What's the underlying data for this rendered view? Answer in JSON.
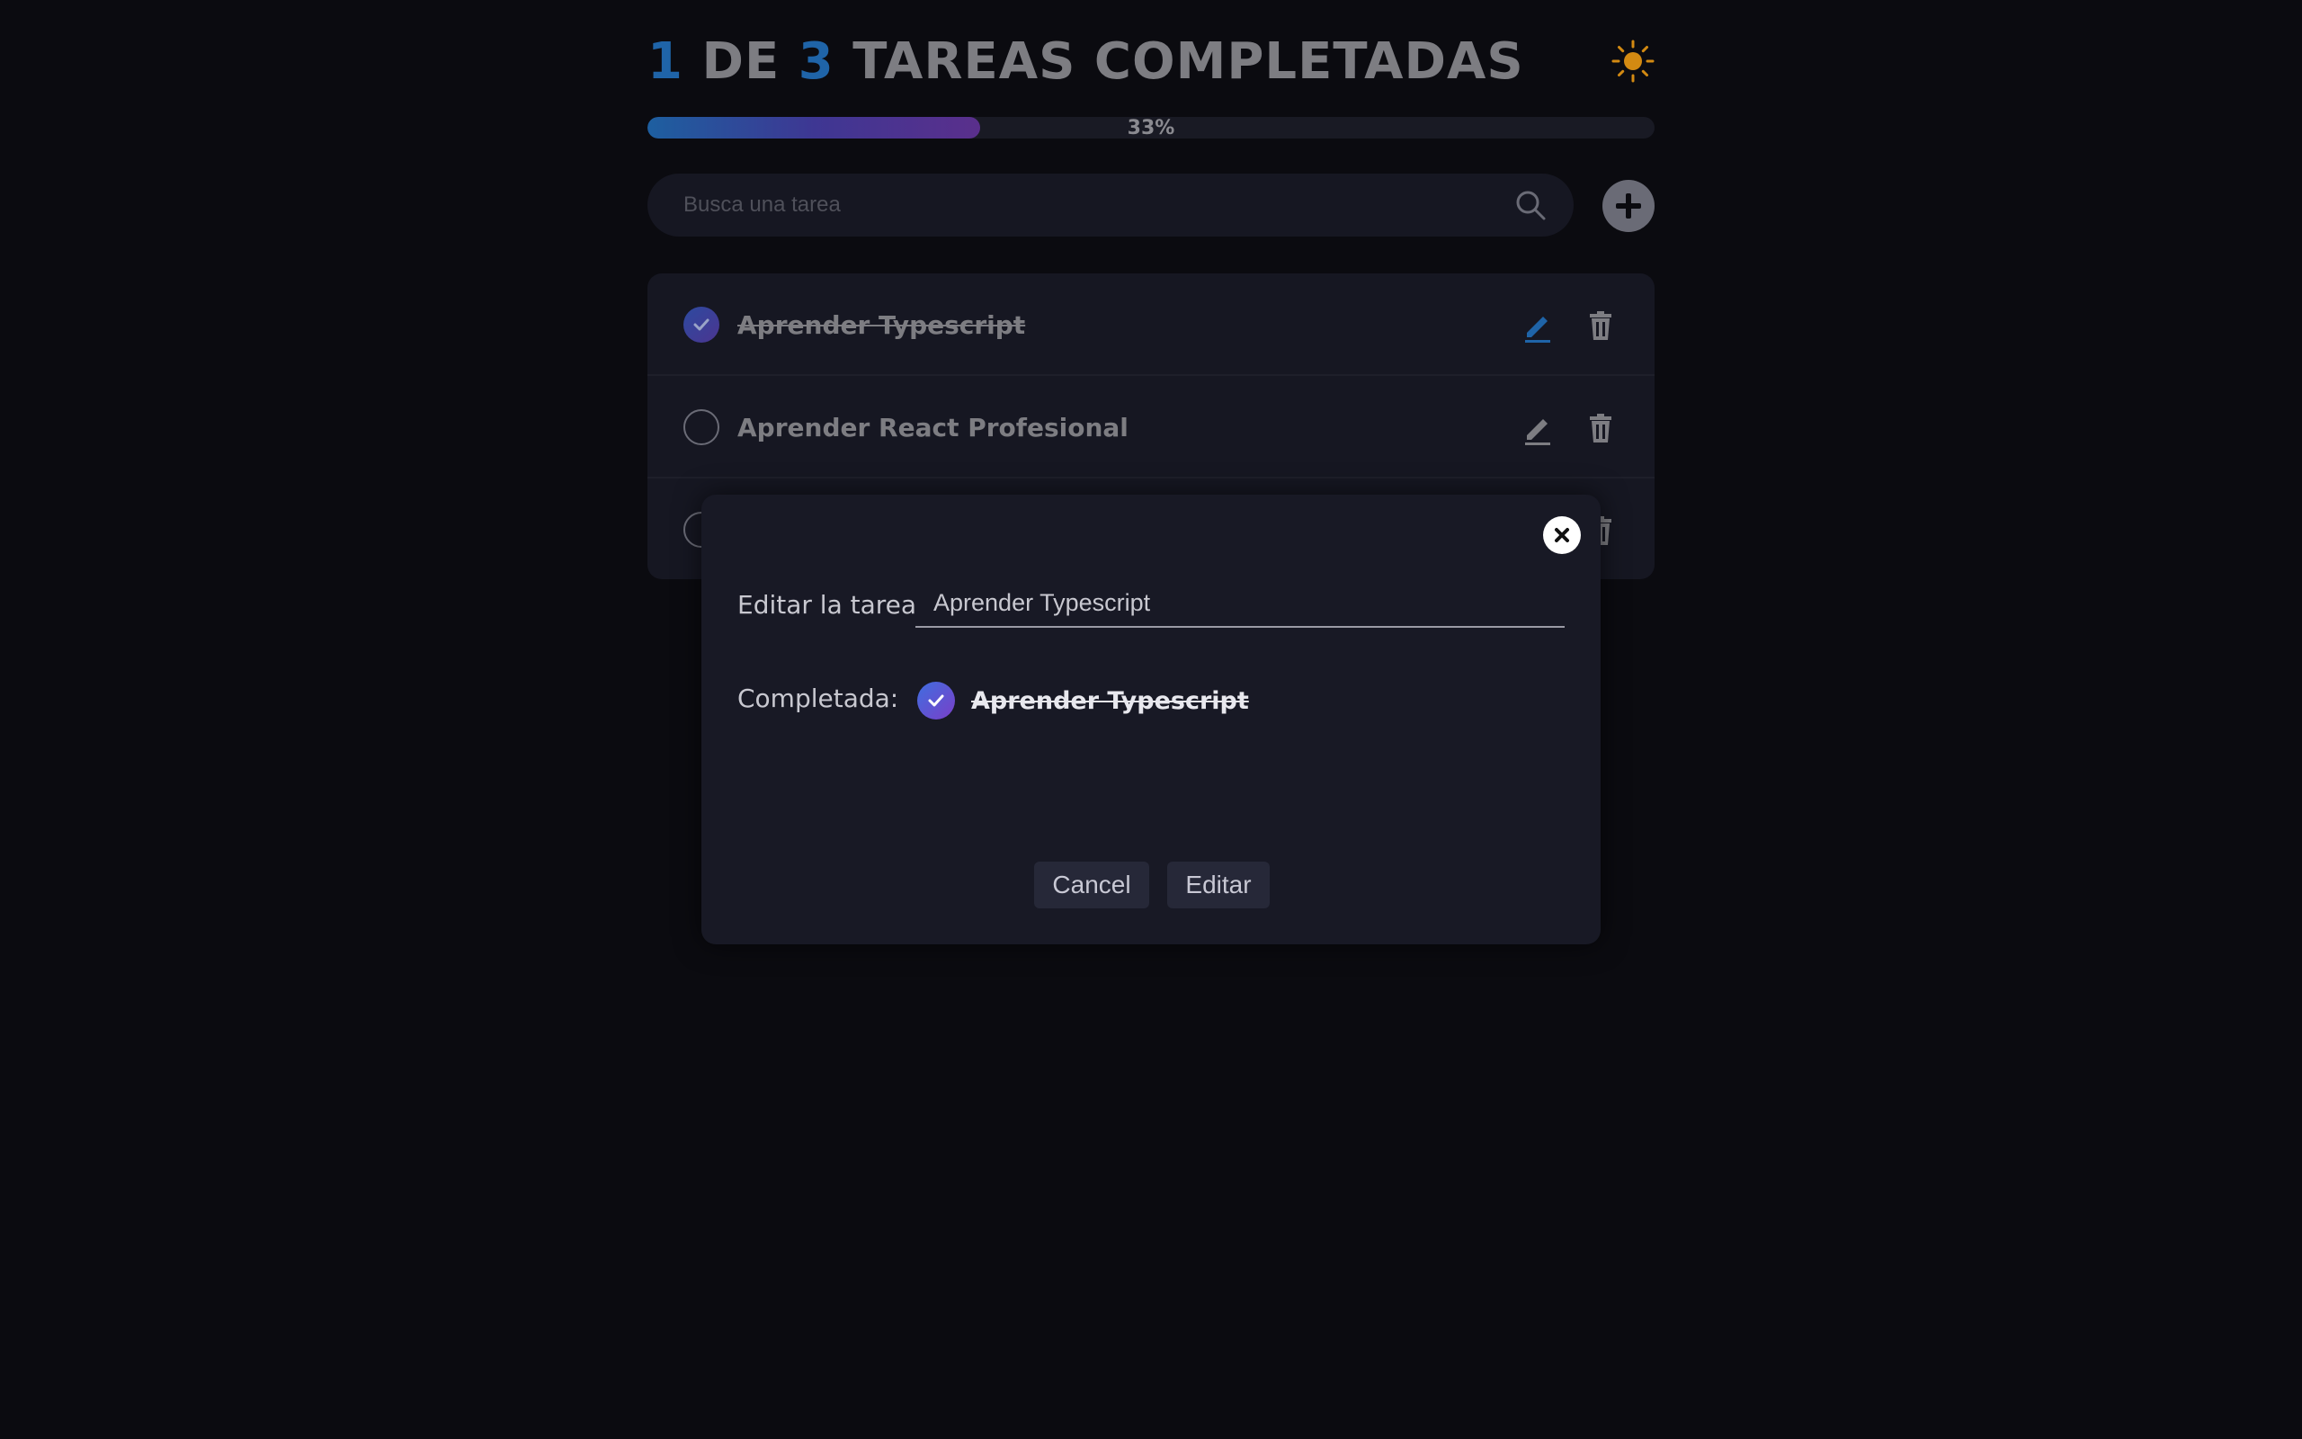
{
  "header": {
    "completed": "1",
    "of": "DE",
    "total": "3",
    "suffix": "TAREAS COMPLETADAS",
    "theme_icon": "sun-icon"
  },
  "progress": {
    "percent": 33,
    "label": "33%"
  },
  "search": {
    "placeholder": "Busca una tarea",
    "value": ""
  },
  "todos": [
    {
      "text": "Aprender Typescript",
      "completed": true
    },
    {
      "text": "Aprender React Profesional",
      "completed": false
    },
    {
      "text": "",
      "completed": false
    }
  ],
  "modal": {
    "edit_label": "Editar la tarea",
    "edit_value": "Aprender Typescript",
    "completed_label": "Completada:",
    "task_text": "Aprender Typescript",
    "task_completed": true,
    "cancel_label": "Cancel",
    "submit_label": "Editar"
  },
  "colors": {
    "accent": "#1f64a8",
    "sun": "#d38a12",
    "background": "#0b0b10",
    "panel": "#161722"
  }
}
